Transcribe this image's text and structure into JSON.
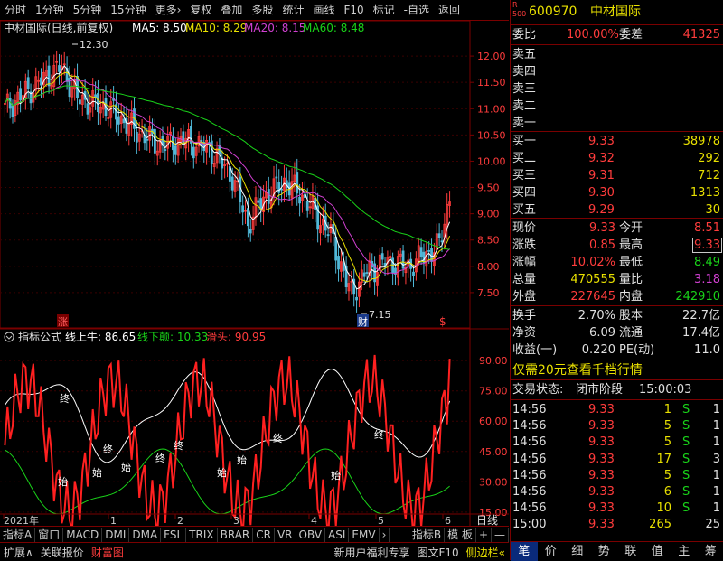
{
  "toolbar": {
    "items": [
      "分时",
      "1分钟",
      "5分钟",
      "15分钟",
      "更多›",
      "复权",
      "叠加",
      "多股",
      "统计",
      "画线",
      "F10",
      "标记",
      "-自选",
      "返回"
    ]
  },
  "chart": {
    "stock_title": "中材国际(日线,前复权)",
    "ma5_label": "MA5: 8.50",
    "ma10_label": "MA10: 8.29",
    "ma20_label": "MA20: 8.15",
    "ma60_label": "MA60: 8.48",
    "high_annotation": "12.30",
    "low_annotation": "7.15",
    "price_ticks": [
      "12.00",
      "11.50",
      "11.00",
      "10.50",
      "10.00",
      "9.50",
      "9.00",
      "8.50",
      "8.00",
      "7.50"
    ],
    "marker_zhang": "涨",
    "marker_cai": "财",
    "marker_dollar": "$",
    "colors": {
      "up": "#ff3c3c",
      "down": "#50b8d8",
      "ma5": "#ffffff",
      "ma10": "#e8e000",
      "ma20": "#d040d0",
      "ma60": "#19d219"
    }
  },
  "indicator": {
    "title": "指标公式",
    "line1_label": "线上牛: 86.65",
    "line2_label": "线下颠: 10.33",
    "line3_label": "滑头: 90.95",
    "ticks": [
      "90.00",
      "75.00",
      "60.00",
      "45.00",
      "30.00",
      "15.00"
    ],
    "mark_zhong": "终",
    "mark_shi": "始"
  },
  "time_axis": {
    "labels": [
      "2021年",
      "1",
      "2",
      "3",
      "4",
      "5",
      "6"
    ],
    "period": "日线"
  },
  "indicator_tabs": [
    "指标A",
    "窗口",
    "MACD",
    "DMI",
    "DMA",
    "FSL",
    "TRIX",
    "BRAR",
    "CR",
    "VR",
    "OBV",
    "ASI",
    "EMV",
    "›",
    "指标B",
    "模 板",
    "+",
    "—"
  ],
  "bottom_bar": {
    "left": [
      "扩展∧",
      "关联报价",
      "财富图"
    ],
    "right": [
      "新用户福利专享",
      "图文F10",
      "侧边栏«"
    ]
  },
  "quote": {
    "badge_top": "R",
    "badge_bottom": "500",
    "code": "600970",
    "name": "中材国际",
    "weibi_label": "委比",
    "weibi_value": "100.00%",
    "weicha_label": "委差",
    "weicha_value": "41325",
    "asks": [
      {
        "label": "卖五",
        "price": "",
        "vol": ""
      },
      {
        "label": "卖四",
        "price": "",
        "vol": ""
      },
      {
        "label": "卖三",
        "price": "",
        "vol": ""
      },
      {
        "label": "卖二",
        "price": "",
        "vol": ""
      },
      {
        "label": "卖一",
        "price": "",
        "vol": ""
      }
    ],
    "bids": [
      {
        "label": "买一",
        "price": "9.33",
        "vol": "38978"
      },
      {
        "label": "买二",
        "price": "9.32",
        "vol": "292"
      },
      {
        "label": "买三",
        "price": "9.31",
        "vol": "712"
      },
      {
        "label": "买四",
        "price": "9.30",
        "vol": "1313"
      },
      {
        "label": "买五",
        "price": "9.29",
        "vol": "30"
      }
    ],
    "stats": [
      {
        "l1": "现价",
        "v1": "9.33",
        "l2": "今开",
        "v2": "8.51"
      },
      {
        "l1": "涨跌",
        "v1": "0.85",
        "l2": "最高",
        "v2": "9.33"
      },
      {
        "l1": "涨幅",
        "v1": "10.02%",
        "l2": "最低",
        "v2": "8.49"
      },
      {
        "l1": "总量",
        "v1": "470555",
        "l2": "量比",
        "v2": "3.18"
      },
      {
        "l1": "外盘",
        "v1": "227645",
        "l2": "内盘",
        "v2": "242910"
      }
    ],
    "stats2": [
      {
        "l1": "换手",
        "v1": "2.70%",
        "l2": "股本",
        "v2": "22.7亿"
      },
      {
        "l1": "净资",
        "v1": "6.09",
        "l2": "流通",
        "v2": "17.4亿"
      },
      {
        "l1": "收益(一)",
        "v1": "0.220",
        "l2": "PE(动)",
        "v2": "11.0"
      }
    ],
    "promo": "仅需20元查看千档行情",
    "status_label": "交易状态:",
    "status_value": "闭市阶段",
    "status_time": "15:00:03",
    "ticks": [
      {
        "t": "14:56",
        "p": "9.33",
        "v": "1",
        "s": "S",
        "n": "1"
      },
      {
        "t": "14:56",
        "p": "9.33",
        "v": "5",
        "s": "S",
        "n": "1"
      },
      {
        "t": "14:56",
        "p": "9.33",
        "v": "5",
        "s": "S",
        "n": "1"
      },
      {
        "t": "14:56",
        "p": "9.33",
        "v": "17",
        "s": "S",
        "n": "3"
      },
      {
        "t": "14:56",
        "p": "9.33",
        "v": "5",
        "s": "S",
        "n": "1"
      },
      {
        "t": "14:56",
        "p": "9.33",
        "v": "6",
        "s": "S",
        "n": "1"
      },
      {
        "t": "14:56",
        "p": "9.33",
        "v": "10",
        "s": "S",
        "n": "1"
      },
      {
        "t": "15:00",
        "p": "9.33",
        "v": "265",
        "s": "",
        "n": "25"
      }
    ],
    "bottom_tabs": [
      "笔",
      "价",
      "细",
      "势",
      "联",
      "值",
      "主",
      "筹"
    ]
  }
}
